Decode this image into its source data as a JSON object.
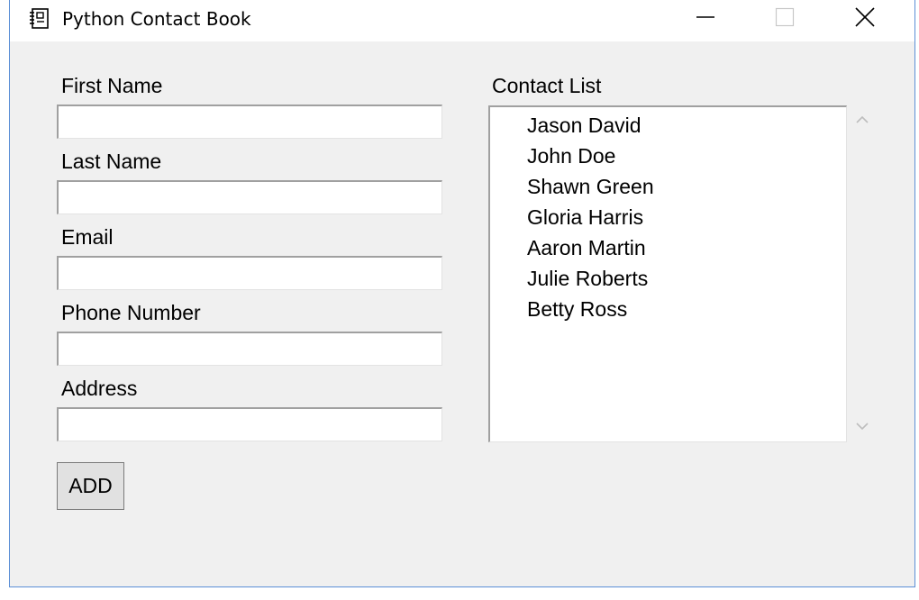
{
  "window": {
    "title": "Python Contact Book",
    "controls": {
      "minimize": "minimize-icon",
      "maximize": "maximize-icon",
      "close": "close-icon"
    }
  },
  "form": {
    "first_name_label": "First Name",
    "first_name_value": "",
    "last_name_label": "Last Name",
    "last_name_value": "",
    "email_label": "Email",
    "email_value": "",
    "phone_label": "Phone Number",
    "phone_value": "",
    "address_label": "Address",
    "address_value": "",
    "add_button_label": "ADD"
  },
  "contacts": {
    "label": "Contact List",
    "items": [
      "Jason David",
      "John Doe",
      "Shawn Green",
      "Gloria Harris",
      "Aaron Martin",
      "Julie Roberts",
      "Betty Ross"
    ]
  },
  "colors": {
    "window_bg": "#f0f0f0",
    "titlebar_bg": "#ffffff",
    "border_accent": "#5b8fd6"
  }
}
